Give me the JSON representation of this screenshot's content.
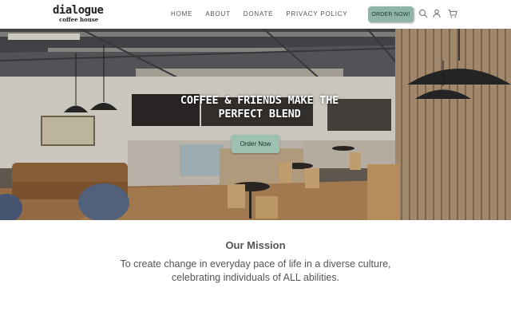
{
  "brand": {
    "name": "dialogue",
    "tagline": "coffee house"
  },
  "nav": {
    "items": [
      {
        "label": "HOME"
      },
      {
        "label": "ABOUT"
      },
      {
        "label": "DONATE"
      },
      {
        "label": "PRIVACY POLICY"
      }
    ],
    "order_button": "ORDER NOW!",
    "icons": [
      "search-icon",
      "user-icon",
      "cart-icon"
    ]
  },
  "hero": {
    "title_line1": "COFFEE & FRIENDS MAKE THE",
    "title_line2": "PERFECT BLEND",
    "button": "Order Now"
  },
  "mission": {
    "title": "Our Mission",
    "text": "To create change in everyday pace of life in a diverse culture, celebrating individuals of ALL abilities."
  },
  "colors": {
    "accent": "#8fb5a6",
    "text": "#555555",
    "background": "#ffffff"
  }
}
